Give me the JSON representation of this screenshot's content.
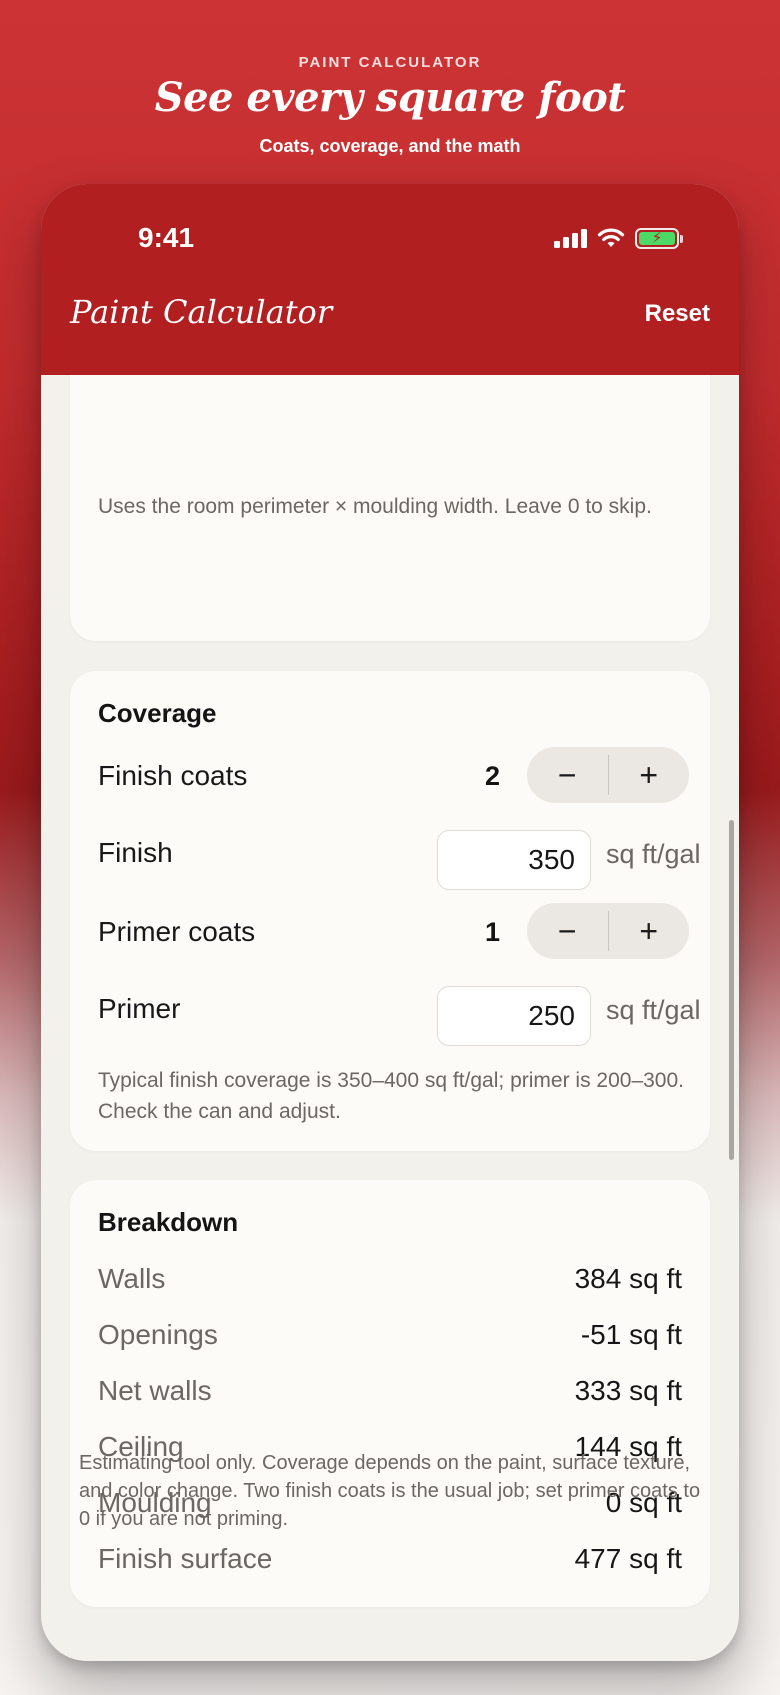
{
  "hero": {
    "eyebrow": "PAINT CALCULATOR",
    "title": "See every square foot",
    "subtitle": "Coats, coverage, and the math"
  },
  "status": {
    "time": "9:41",
    "icons": [
      "cellular-signal-icon",
      "wifi-icon",
      "battery-charging-icon"
    ]
  },
  "appbar": {
    "title": "Paint Calculator",
    "reset_label": "Reset"
  },
  "moulding_note": "Uses the room perimeter × moulding width. Leave 0 to skip.",
  "coverage": {
    "heading": "Coverage",
    "finish_coats": {
      "label": "Finish coats",
      "value": "2",
      "minus": "−",
      "plus": "+"
    },
    "finish": {
      "label": "Finish",
      "value": "350",
      "unit": "sq ft/gal"
    },
    "primer_coats": {
      "label": "Primer coats",
      "value": "1",
      "minus": "−",
      "plus": "+"
    },
    "primer": {
      "label": "Primer",
      "value": "250",
      "unit": "sq ft/gal"
    },
    "note": "Typical finish coverage is 350–400 sq ft/gal; primer is 200–300. Check the can and adjust."
  },
  "breakdown": {
    "heading": "Breakdown",
    "rows": [
      {
        "label": "Walls",
        "value": "384 sq ft"
      },
      {
        "label": "Openings",
        "value": "-51 sq ft"
      },
      {
        "label": "Net walls",
        "value": "333 sq ft"
      },
      {
        "label": "Ceiling",
        "value": "144 sq ft"
      },
      {
        "label": "Moulding",
        "value": "0 sq ft"
      },
      {
        "label": "Finish surface",
        "value": "477 sq ft"
      }
    ]
  },
  "disclaimer": "Estimating tool only. Coverage depends on the paint, surface texture, and color change. Two finish coats is the usual job; set primer coats to 0 if you are not priming.",
  "colors": {
    "brand_red": "#b11f21",
    "card_bg": "#fdfbf7",
    "screen_bg": "#f3f1ec",
    "battery_green": "#4cd964"
  }
}
